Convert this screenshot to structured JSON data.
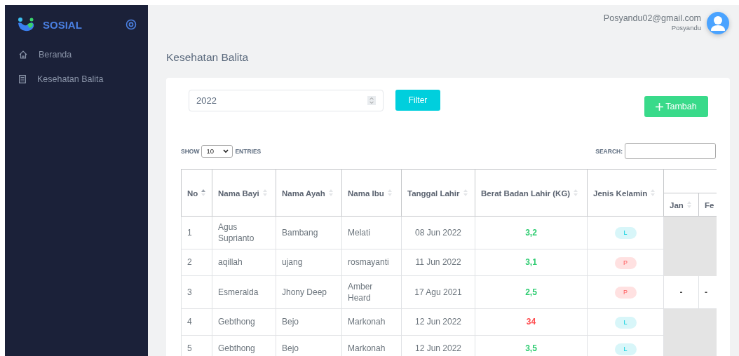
{
  "sidebar": {
    "brand": "SOSIAL",
    "items": [
      {
        "label": "Beranda",
        "selected": false
      },
      {
        "label": "Kesehatan Balita",
        "selected": false
      }
    ]
  },
  "header": {
    "email": "Posyandu02@gmail.com",
    "role": "Posyandu"
  },
  "page_title": "Kesehatan Balita",
  "filter": {
    "year": "2022",
    "button": "Filter"
  },
  "add_button": "Tambah",
  "table_controls": {
    "show_label": "SHOW",
    "entries_value": "10",
    "entries_label": "ENTRIES",
    "search_label": "SEARCH:"
  },
  "table": {
    "columns": [
      {
        "label": "No",
        "sorted": true
      },
      {
        "label": "Nama Bayi",
        "sorted": false
      },
      {
        "label": "Nama Ayah",
        "sorted": false
      },
      {
        "label": "Nama Ibu",
        "sorted": false
      },
      {
        "label": "Tanggal Lahir",
        "sorted": false
      },
      {
        "label": "Berat Badan Lahir (KG)",
        "sorted": false
      },
      {
        "label": "Jenis Kelamin",
        "sorted": false
      }
    ],
    "month_columns": [
      {
        "label": "Jan",
        "sortable": true
      },
      {
        "label": "Fe",
        "sortable": false
      }
    ],
    "rows": [
      {
        "no": "1",
        "bayi": "Agus Suprianto",
        "ayah": "Bambang",
        "ibu": "Melati",
        "tanggal": "08 Jun 2022",
        "berat": {
          "text": "3,2",
          "color": "#2ecc71"
        },
        "gender": {
          "text": "L",
          "kind": "male"
        },
        "months": [
          {
            "kind": "blank"
          },
          {
            "kind": "blank"
          }
        ]
      },
      {
        "no": "2",
        "bayi": "aqillah",
        "ayah": "ujang",
        "ibu": "rosmayanti",
        "tanggal": "11 Jun 2022",
        "berat": {
          "text": "3,1",
          "color": "#2ecc71"
        },
        "gender": {
          "text": "P",
          "kind": "female"
        },
        "months": [
          {
            "kind": "blank"
          },
          {
            "kind": "blank"
          }
        ]
      },
      {
        "no": "3",
        "bayi": "Esmeralda",
        "ayah": "Jhony Deep",
        "ibu": "Amber Heard",
        "tanggal": "17 Agu 2021",
        "berat": {
          "text": "2,5",
          "color": "#2ecc71"
        },
        "gender": {
          "text": "P",
          "kind": "female"
        },
        "months": [
          {
            "kind": "value",
            "text": "-"
          },
          {
            "kind": "value",
            "text": "-"
          }
        ]
      },
      {
        "no": "4",
        "bayi": "Gebthong",
        "ayah": "Bejo",
        "ibu": "Markonah",
        "tanggal": "12 Jun 2022",
        "berat": {
          "text": "34",
          "color": "#ff4d4f"
        },
        "gender": {
          "text": "L",
          "kind": "male"
        },
        "months": [
          {
            "kind": "blank"
          },
          {
            "kind": "blank"
          }
        ]
      },
      {
        "no": "5",
        "bayi": "Gebthong",
        "ayah": "Bejo",
        "ibu": "Markonah",
        "tanggal": "12 Jun 2022",
        "berat": {
          "text": "3,5",
          "color": "#2ecc71"
        },
        "gender": {
          "text": "L",
          "kind": "male"
        },
        "months": [
          {
            "kind": "blank"
          },
          {
            "kind": "blank"
          }
        ]
      }
    ]
  }
}
